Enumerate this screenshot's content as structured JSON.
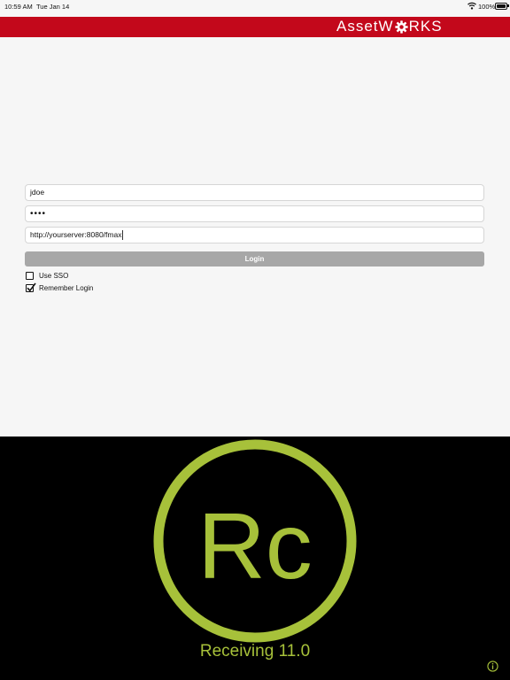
{
  "status_bar": {
    "time": "10:59 AM",
    "date": "Tue Jan 14",
    "battery": "100%"
  },
  "brand": {
    "name_left": "Asset",
    "name_w": "W",
    "name_right": "RKS",
    "color": "#c3081b"
  },
  "login_form": {
    "username": "jdoe",
    "password_masked": "••••",
    "server_url": "http://yourserver:8080/fmax",
    "login_label": "Login",
    "use_sso_label": "Use SSO",
    "use_sso_checked": false,
    "remember_label": "Remember Login",
    "remember_checked": true
  },
  "splash": {
    "logo_text": "Rc",
    "caption": "Receiving 11.0",
    "accent": "#a7c13a",
    "info_icon": "info-icon"
  }
}
